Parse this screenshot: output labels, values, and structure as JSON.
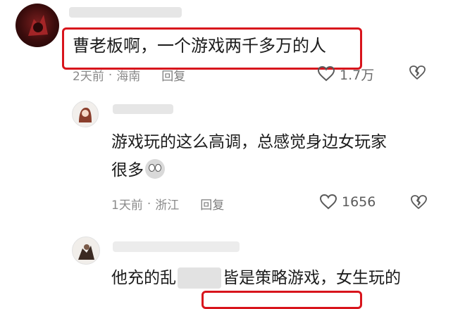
{
  "comments": [
    {
      "text": "曹老板啊，一个游戏两千多万的人",
      "time": "2天前",
      "location": "海南",
      "reply_label": "回复",
      "likes": "1.7万"
    },
    {
      "text_line1": "游戏玩的这么高调，总感觉身边女玩家",
      "text_line2": "很多",
      "time": "1天前",
      "location": "浙江",
      "reply_label": "回复",
      "likes": "1656"
    },
    {
      "text_before_blur": "他充的乱",
      "text_after_blur": "皆是策略游戏，女生玩的"
    }
  ],
  "separator": "·",
  "colors": {
    "highlight_border": "#d8141c",
    "meta_text": "#8a8a8a",
    "redacted": "#e2e2e2"
  },
  "icons": [
    "heart-outline-icon",
    "broken-heart-icon",
    "emoji-icon"
  ]
}
